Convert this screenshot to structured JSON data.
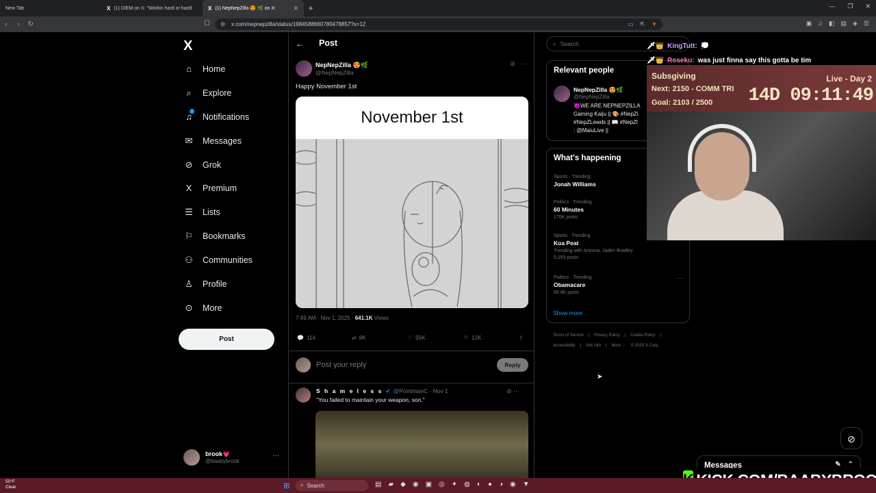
{
  "browser": {
    "tabs": [
      {
        "label": "New Tab",
        "icon": ""
      },
      {
        "label": "(1) DIEM on X: \"Workin hard or hardl",
        "icon": "X"
      },
      {
        "label": "(1) NepNepZilla 😍 🌿 on X: ",
        "icon": "X"
      }
    ],
    "url": "x.com/nepnepzilla/status/1984588660780478857?s=12"
  },
  "nav": {
    "logo": "X",
    "items": [
      {
        "label": "Home",
        "icon": "⌂"
      },
      {
        "label": "Explore",
        "icon": "⌕"
      },
      {
        "label": "Notifications",
        "icon": "🔔"
      },
      {
        "label": "Messages",
        "icon": "✉"
      },
      {
        "label": "Grok",
        "icon": "⊘"
      },
      {
        "label": "Premium",
        "icon": "X"
      },
      {
        "label": "Lists",
        "icon": "☰"
      },
      {
        "label": "Bookmarks",
        "icon": "🔖"
      },
      {
        "label": "Communities",
        "icon": "👥"
      },
      {
        "label": "Profile",
        "icon": "👤"
      },
      {
        "label": "More",
        "icon": "⋯"
      }
    ],
    "post_button": "Post",
    "me": {
      "name": "brook💗",
      "handle": "@baabybrook"
    }
  },
  "post": {
    "header": "Post",
    "author_name": "NepNepZilla 😍🌿",
    "author_handle": "@NepNepZilla",
    "text": "Happy November 1st",
    "media_caption": "November 1st",
    "time": "7:49 AM · Nov 1, 2025 · ",
    "views_count": "641.1K",
    "views_label": " Views",
    "actions": {
      "replies": "114",
      "reposts": "8K",
      "likes": "55K",
      "bookmarks": "12K"
    },
    "reply_placeholder": "Post your reply",
    "reply_button": "Reply"
  },
  "reply_post": {
    "name": "S h a m e l e s s",
    "handle": "@PointmanC · Nov 1",
    "text": "\"You failed to maintain your weapon, son.\""
  },
  "sidebar": {
    "search_placeholder": "Search",
    "relevant_title": "Relevant people",
    "person": {
      "name": "NepNepZilla 😍🌿",
      "handle": "@NepNepZilla",
      "bio1": "😈WE ARE NEPNEPZILLA",
      "bio2": "Gaming Kaiju || 🎨 #NepZi",
      "bio3": "#NepZLewds || 📖 #NepZl",
      "bio4": ": @MaiuLive ||"
    },
    "happening_title": "What's happening",
    "trends": [
      {
        "category": "Sports · Trending",
        "title": "Jonah Williams",
        "sub": ""
      },
      {
        "category": "Politics · Trending",
        "title": "60 Minutes",
        "sub": "170K posts"
      },
      {
        "category": "Sports · Trending",
        "title": "Koa Peat",
        "sub": "Trending with Arizona, Jaden Bradley",
        "sub2": "5,293 posts"
      },
      {
        "category": "Politics · Trending",
        "title": "Obamacare",
        "sub": "89.8K posts"
      }
    ],
    "show_more": "Show more",
    "footer1": [
      "Terms of Service",
      "|",
      "Privacy Policy",
      "|",
      "Cookie Policy",
      "|"
    ],
    "footer2": [
      "Accessibility",
      "|",
      "Ads info",
      "|",
      "More ···",
      "© 2025 X Corp."
    ]
  },
  "stream": {
    "chat": [
      {
        "user": "KingTutt:",
        "msg": "💭"
      },
      {
        "user": "Roseku:",
        "msg": "was just finna say this gotta be tim"
      }
    ],
    "sub_title": "Subsgiving",
    "sub_next": "Next: 2150 - COMM TRI",
    "sub_goal": "Goal: 2103 / 2500",
    "live_day": "Live - Day 2",
    "timer": "14D 09:11:49",
    "kick_url": "KICK.COM/BAABYBROOK",
    "kick_logo": "K"
  },
  "messages_drawer": "Messages",
  "taskbar": {
    "weather_temp": "50°F",
    "weather_desc": "Clear",
    "search": "Search"
  }
}
